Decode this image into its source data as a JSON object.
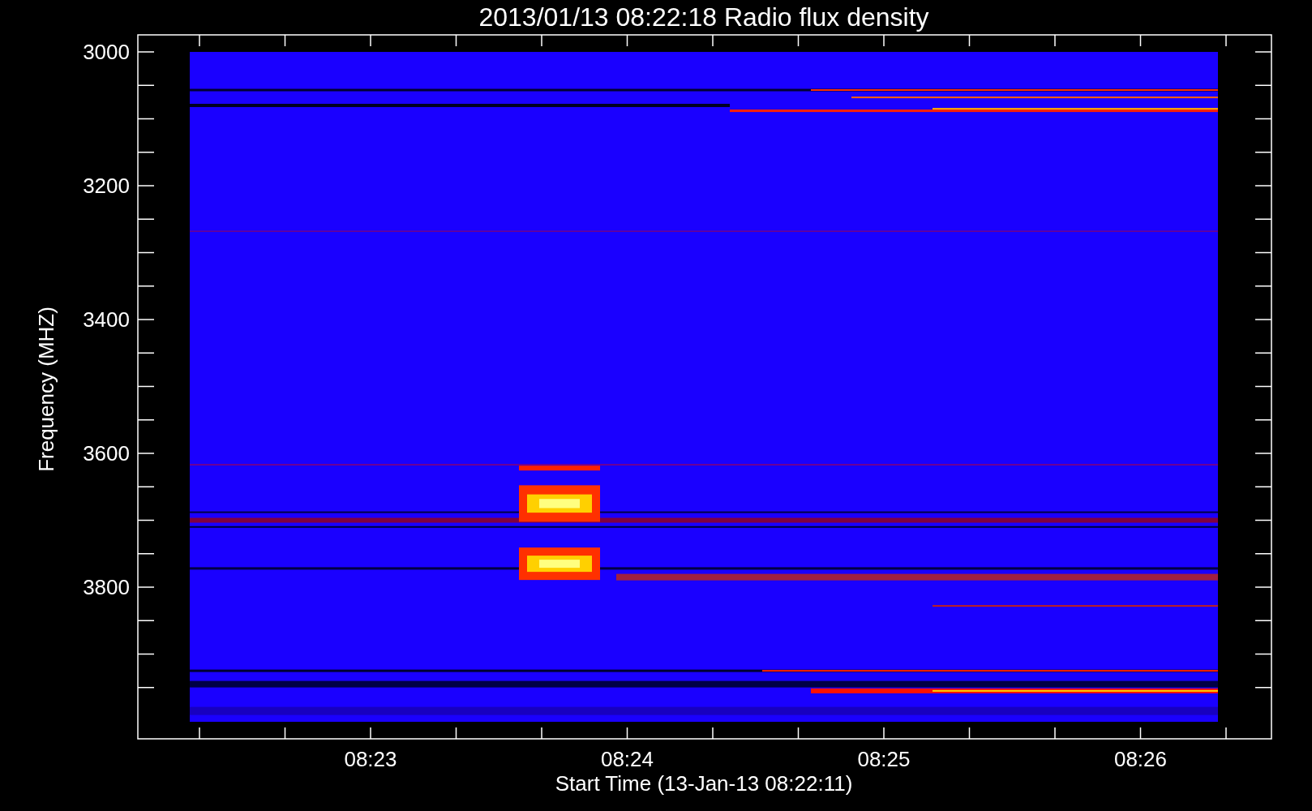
{
  "title": "2013/01/13 08:22:18 Radio flux density",
  "y_axis": {
    "label": "Frequency (MHZ)",
    "ticks": [
      "3000",
      "3200",
      "3400",
      "3600",
      "3800"
    ]
  },
  "x_axis": {
    "label": "Start Time (13-Jan-13 08:22:11)",
    "ticks": [
      "08:23",
      "08:24",
      "08:25",
      "08:26"
    ]
  }
}
